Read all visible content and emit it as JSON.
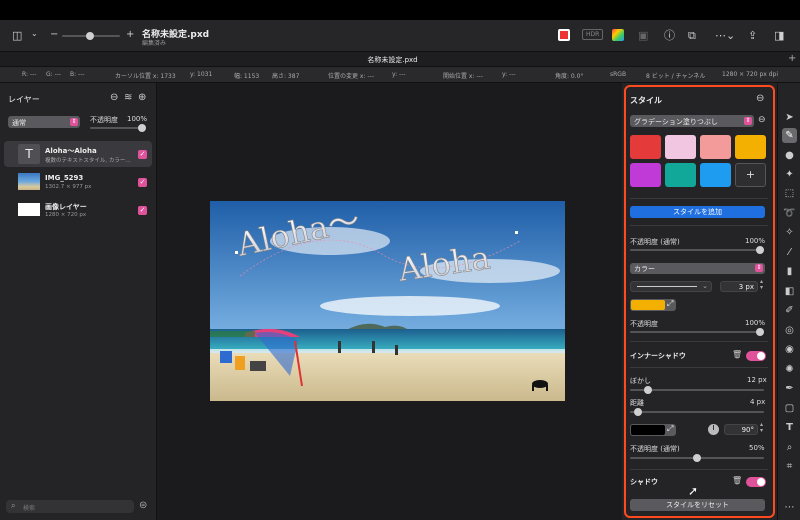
{
  "toolbar": {
    "doc_title": "名称未設定.pxd",
    "doc_subtitle": "編集済み",
    "hdr_label": "HDR",
    "zoom_minus": "−",
    "zoom_plus": "+"
  },
  "tab": {
    "label": "名称未設定.pxd"
  },
  "infobar": {
    "r": "R: ---",
    "g": "G: ---",
    "b": "B: ---",
    "cursor_x": "カーソル位置 x: 1733",
    "cursor_y": "y: 1031",
    "width": "幅: 1153",
    "height": "高さ: 387",
    "pos_x": "位置の変更 x: ---",
    "pos_y": "y: ---",
    "start_x": "開始位置 x: ---",
    "start_y": "y: ---",
    "angle": "角度: 0.0°",
    "color_space": "sRGB",
    "bit_depth": "8 ビット / チャンネル",
    "doc_size": "1280 × 720 px dpi"
  },
  "layers": {
    "title": "レイヤー",
    "blend_mode": "通常",
    "opacity_label": "不透明度",
    "opacity_value": "100%",
    "items": [
      {
        "name": "Aloha〜Aloha",
        "desc": "複数のテキストスタイル, カラー…",
        "thumb": "T"
      },
      {
        "name": "IMG_5293",
        "desc": "1302.7 × 977 px",
        "thumb": ""
      },
      {
        "name": "画像レイヤー",
        "desc": "1280 × 720 px",
        "thumb": ""
      }
    ],
    "search_placeholder": "検索"
  },
  "canvas": {
    "text_left": "Aloha〜",
    "text_right": "Aloha"
  },
  "style": {
    "title": "スタイル",
    "fill_type": "グラデーション塗りつぶし",
    "swatch_colors": [
      "#e53a3a",
      "#f0c6e0",
      "#f39a9a",
      "#f4b000",
      "#c03ad8",
      "#11a89a",
      "#1e9cf0"
    ],
    "add_swatch": "+",
    "add_style_button": "スタイルを追加",
    "opacity_normal_label": "不透明度 (通常)",
    "opacity_normal_value": "100%",
    "color_mode": "カラー",
    "stroke_width": "3 px",
    "stroke_color": "#f4b000",
    "opacity_label": "不透明度",
    "opacity_value": "100%",
    "inner_shadow_label": "インナーシャドウ",
    "blur_label": "ぼかし",
    "blur_value": "12 px",
    "distance_label": "距離",
    "distance_value": "4 px",
    "shadow_color": "#000000",
    "angle_value": "90°",
    "shadow_opacity_label": "不透明度 (通常)",
    "shadow_opacity_value": "50%",
    "shadow_label": "シャドウ",
    "reset_button": "スタイルをリセット"
  },
  "accent": "#e0529a",
  "highlight_border": "#ff4a1f"
}
